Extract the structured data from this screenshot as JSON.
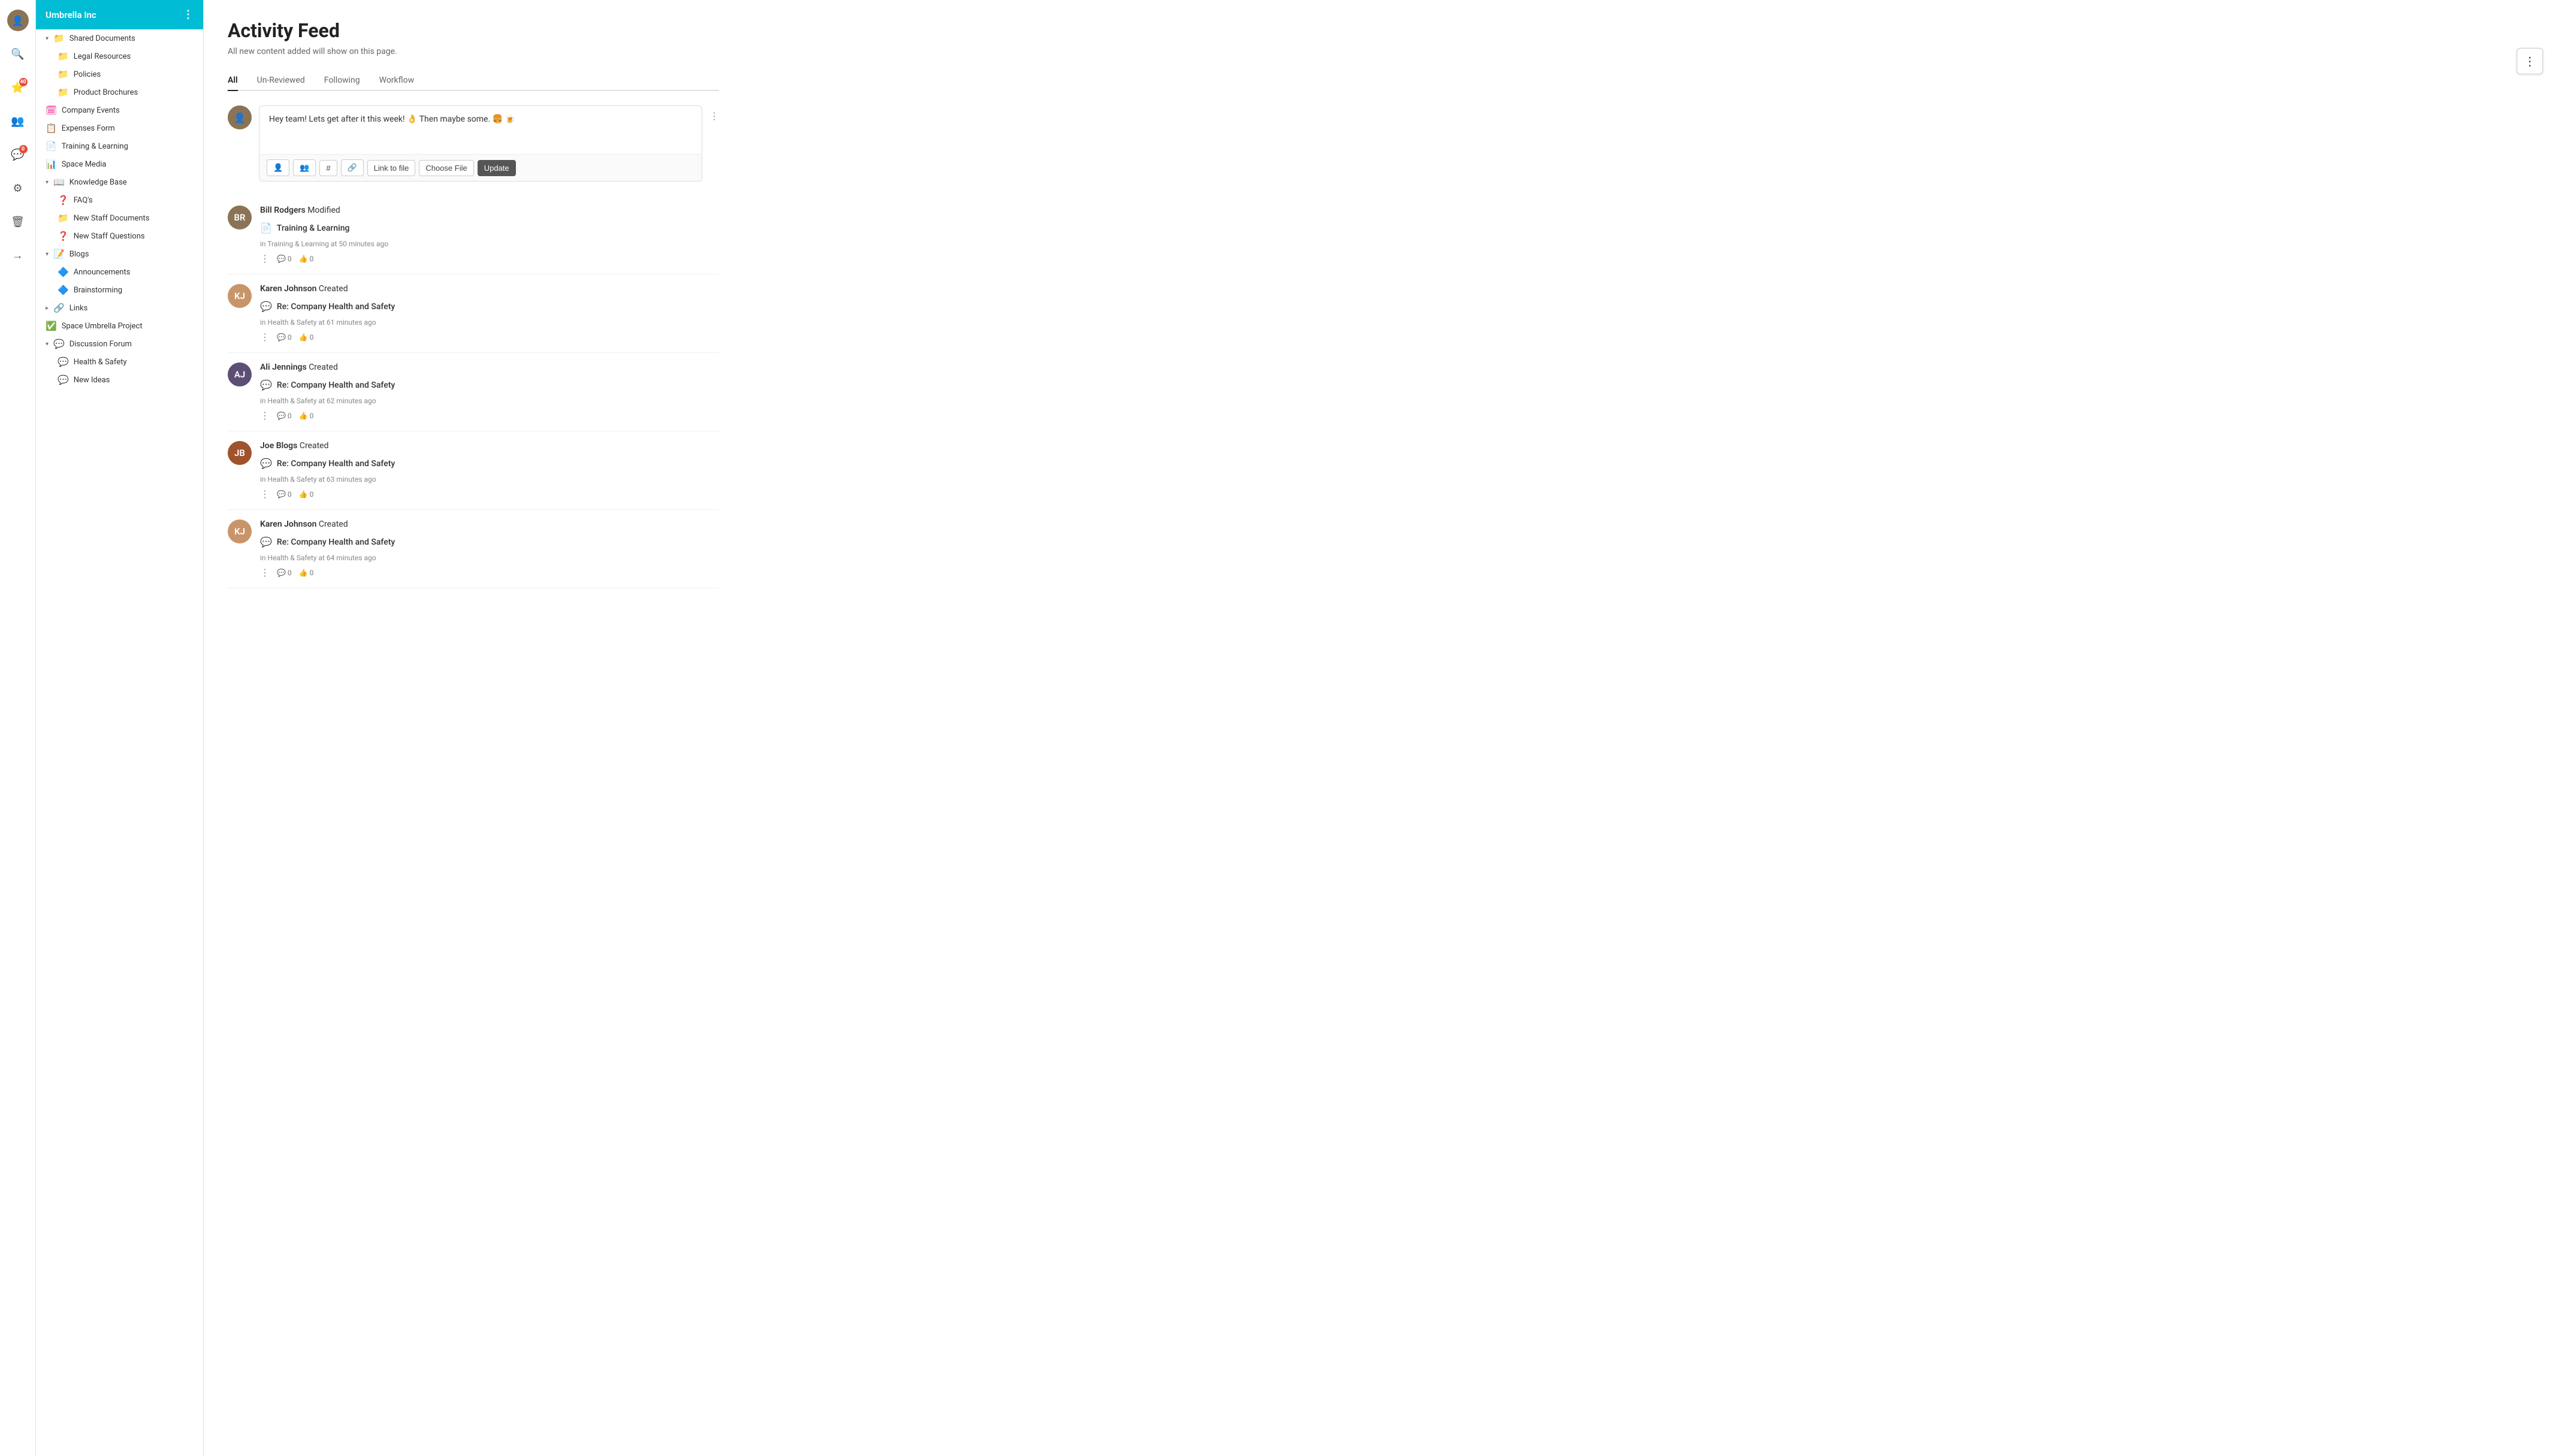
{
  "iconBar": {
    "avatar": "👤",
    "search": "🔍",
    "star": "⭐",
    "starBadge": "40",
    "people": "👥",
    "chat": "💬",
    "chatBadge": "0",
    "settings": "⚙",
    "trash": "🗑",
    "signout": "→"
  },
  "sidebar": {
    "orgName": "Umbrella Inc",
    "sections": [
      {
        "label": "Shared Documents",
        "expanded": true,
        "icon": "folder",
        "iconClass": "icon-folder",
        "indented": false,
        "children": [
          {
            "label": "Legal Resources",
            "icon": "📁",
            "iconClass": "icon-folder",
            "indented": true
          },
          {
            "label": "Policies",
            "icon": "📁",
            "iconClass": "icon-folder",
            "indented": true
          },
          {
            "label": "Product Brochures",
            "icon": "📁",
            "iconClass": "icon-folder",
            "indented": true
          }
        ]
      },
      {
        "label": "Company Events",
        "icon": "🗓",
        "iconClass": "icon-pink-folder",
        "indented": false
      },
      {
        "label": "Expenses Form",
        "icon": "📋",
        "iconClass": "icon-green-stack",
        "indented": false
      },
      {
        "label": "Training & Learning",
        "icon": "📄",
        "iconClass": "icon-orange-doc",
        "indented": false
      },
      {
        "label": "Space Media",
        "icon": "📊",
        "iconClass": "icon-green-sheet",
        "indented": false
      },
      {
        "label": "Knowledge Base",
        "expanded": true,
        "icon": "📖",
        "iconClass": "icon-kb",
        "indented": false,
        "children": [
          {
            "label": "FAQ's",
            "icon": "❓",
            "iconClass": "icon-faq",
            "indented": true
          },
          {
            "label": "New Staff Documents",
            "icon": "📁",
            "iconClass": "icon-folder",
            "indented": true
          },
          {
            "label": "New Staff Questions",
            "icon": "❓",
            "iconClass": "icon-faq",
            "indented": true
          }
        ]
      },
      {
        "label": "Blogs",
        "expanded": true,
        "icon": "📝",
        "iconClass": "icon-kb",
        "indented": false,
        "children": [
          {
            "label": "Announcements",
            "icon": "🔷",
            "iconClass": "icon-blue-grid",
            "indented": true
          },
          {
            "label": "Brainstorming",
            "icon": "🔷",
            "iconClass": "icon-blue-grid",
            "indented": true
          }
        ]
      },
      {
        "label": "Links",
        "icon": "🔗",
        "iconClass": "icon-links",
        "indented": false,
        "expanded": false
      },
      {
        "label": "Space Umbrella Project",
        "icon": "✅",
        "iconClass": "icon-red-check",
        "indented": false
      },
      {
        "label": "Discussion Forum",
        "expanded": true,
        "icon": "💬",
        "iconClass": "icon-chat",
        "indented": false,
        "children": [
          {
            "label": "Health & Safety",
            "icon": "💬",
            "iconClass": "icon-chat",
            "indented": true
          },
          {
            "label": "New Ideas",
            "icon": "💬",
            "iconClass": "icon-chat",
            "indented": true
          }
        ]
      }
    ]
  },
  "page": {
    "title": "Activity Feed",
    "subtitle": "All new content added will show on this page."
  },
  "tabs": [
    {
      "label": "All",
      "active": true
    },
    {
      "label": "Un-Reviewed",
      "active": false
    },
    {
      "label": "Following",
      "active": false
    },
    {
      "label": "Workflow",
      "active": false
    }
  ],
  "postEditor": {
    "content": "Hey team! Lets get after it this week! 👌  Then maybe some. 🍔 🍺",
    "toolbarButtons": [
      {
        "label": "👤",
        "id": "mention-user"
      },
      {
        "label": "👥",
        "id": "mention-group"
      },
      {
        "label": "#",
        "id": "hashtag"
      },
      {
        "label": "🔗",
        "id": "link"
      },
      {
        "label": "Link to file",
        "id": "link-to-file"
      },
      {
        "label": "Choose File",
        "id": "choose-file"
      },
      {
        "label": "Update",
        "id": "update",
        "primary": true
      }
    ]
  },
  "activities": [
    {
      "id": 1,
      "user": "Bill Rodgers",
      "action": "Modified",
      "avatarBg": "#8B7355",
      "avatarText": "BR",
      "itemIcon": "📄",
      "itemTitle": "Training & Learning",
      "itemMeta": "in Training & Learning at 50 minutes ago",
      "comments": 0,
      "likes": 0
    },
    {
      "id": 2,
      "user": "Karen Johnson",
      "action": "Created",
      "avatarBg": "#C8956A",
      "avatarText": "KJ",
      "itemIcon": "💬",
      "itemTitle": "Re: Company Health and Safety",
      "itemMeta": "in Health & Safety at 61 minutes ago",
      "comments": 0,
      "likes": 0
    },
    {
      "id": 3,
      "user": "Ali Jennings",
      "action": "Created",
      "avatarBg": "#5D4E75",
      "avatarText": "AJ",
      "itemIcon": "💬",
      "itemTitle": "Re: Company Health and Safety",
      "itemMeta": "in Health & Safety at 62 minutes ago",
      "comments": 0,
      "likes": 0
    },
    {
      "id": 4,
      "user": "Joe Blogs",
      "action": "Created",
      "avatarBg": "#A0522D",
      "avatarText": "JB",
      "itemIcon": "💬",
      "itemTitle": "Re: Company Health and Safety",
      "itemMeta": "in Health & Safety at 63 minutes ago",
      "comments": 0,
      "likes": 0
    },
    {
      "id": 5,
      "user": "Karen Johnson",
      "action": "Created",
      "avatarBg": "#C8956A",
      "avatarText": "KJ",
      "itemIcon": "💬",
      "itemTitle": "Re: Company Health and Safety",
      "itemMeta": "in Health & Safety at 64 minutes ago",
      "comments": 0,
      "likes": 0
    }
  ],
  "optionsButton": {
    "icon": "⋮"
  }
}
